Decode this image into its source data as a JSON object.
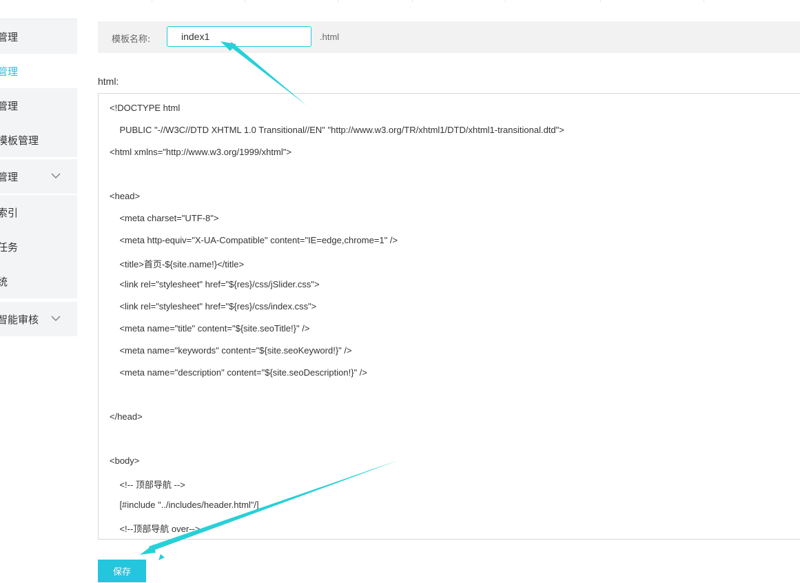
{
  "sidebar": {
    "items": [
      {
        "label": "管理",
        "active": false,
        "has_chevron": false
      },
      {
        "label": "管理",
        "active": true,
        "has_chevron": false
      },
      {
        "label": "管理",
        "active": false,
        "has_chevron": false
      },
      {
        "label": "模板管理",
        "active": false,
        "has_chevron": false
      },
      {
        "label": "管理",
        "active": false,
        "has_chevron": true
      },
      {
        "label": "索引",
        "active": false,
        "has_chevron": false
      },
      {
        "label": "任务",
        "active": false,
        "has_chevron": false
      },
      {
        "label": "统",
        "active": false,
        "has_chevron": false
      },
      {
        "label": "智能审核",
        "active": false,
        "has_chevron": true
      }
    ]
  },
  "form": {
    "name_label": "模板名称:",
    "name_value": "index1",
    "suffix": ".html",
    "html_label": "html:"
  },
  "code_lines": [
    "<!DOCTYPE html",
    "    PUBLIC \"-//W3C//DTD XHTML 1.0 Transitional//EN\" \"http://www.w3.org/TR/xhtml1/DTD/xhtml1-transitional.dtd\">",
    "<html xmlns=\"http://www.w3.org/1999/xhtml\">",
    "",
    "<head>",
    "    <meta charset=\"UTF-8\">",
    "    <meta http-equiv=\"X-UA-Compatible\" content=\"IE=edge,chrome=1\" />",
    "    <title>首页-${site.name!}</title>",
    "    <link rel=\"stylesheet\" href=\"${res}/css/jSlider.css\">",
    "    <link rel=\"stylesheet\" href=\"${res}/css/index.css\">",
    "    <meta name=\"title\" content=\"${site.seoTitle!}\" />",
    "    <meta name=\"keywords\" content=\"${site.seoKeyword!}\" />",
    "    <meta name=\"description\" content=\"${site.seoDescription!}\" />",
    "",
    "</head>",
    "",
    "<body>",
    "    <!-- 顶部导航 -->",
    "    [#include \"../includes/header.html\"/]",
    "    <!--顶部导航 over-->"
  ],
  "actions": {
    "save_label": "保存"
  },
  "colors": {
    "accent": "#23c6dc",
    "sidebar_bg": "#f3f4f6",
    "form_bar_bg": "#f2f2f2"
  },
  "icons": {
    "chevron": "chevron-down-icon"
  }
}
